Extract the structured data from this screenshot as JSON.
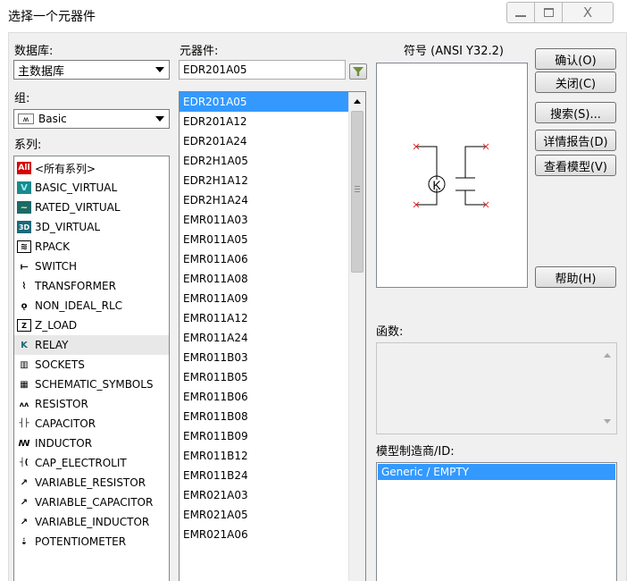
{
  "window": {
    "title": "选择一个元器件",
    "controls": {
      "minimize": "—",
      "maximize": "□",
      "close": "X"
    }
  },
  "database": {
    "label": "数据库:",
    "selected": "主数据库"
  },
  "group": {
    "label": "组:",
    "selected": "Basic"
  },
  "series": {
    "label": "系列:",
    "items": [
      {
        "label": "<所有系列>",
        "icon": "all-series-icon",
        "glyph": "All",
        "selected": false
      },
      {
        "label": "BASIC_VIRTUAL",
        "icon": "basic-virtual-icon",
        "glyph": "V",
        "selected": false
      },
      {
        "label": "RATED_VIRTUAL",
        "icon": "rated-virtual-icon",
        "glyph": "~",
        "selected": false
      },
      {
        "label": "3D_VIRTUAL",
        "icon": "3d-virtual-icon",
        "glyph": "3D",
        "selected": false
      },
      {
        "label": "RPACK",
        "icon": "rpack-icon",
        "glyph": "≋",
        "selected": false
      },
      {
        "label": "SWITCH",
        "icon": "switch-icon",
        "glyph": "⟝",
        "selected": false
      },
      {
        "label": "TRANSFORMER",
        "icon": "transformer-icon",
        "glyph": "⌇",
        "selected": false
      },
      {
        "label": "NON_IDEAL_RLC",
        "icon": "non-ideal-rlc-icon",
        "glyph": "ǫ",
        "selected": false
      },
      {
        "label": "Z_LOAD",
        "icon": "z-load-icon",
        "glyph": "Z",
        "selected": false
      },
      {
        "label": "RELAY",
        "icon": "relay-icon",
        "glyph": "K",
        "selected": true
      },
      {
        "label": "SOCKETS",
        "icon": "sockets-icon",
        "glyph": "▥",
        "selected": false
      },
      {
        "label": "SCHEMATIC_SYMBOLS",
        "icon": "schematic-symbols-icon",
        "glyph": "▦",
        "selected": false
      },
      {
        "label": "RESISTOR",
        "icon": "resistor-icon",
        "glyph": "ʌʌ",
        "selected": false
      },
      {
        "label": "CAPACITOR",
        "icon": "capacitor-icon",
        "glyph": "┤├",
        "selected": false
      },
      {
        "label": "INDUCTOR",
        "icon": "inductor-icon",
        "glyph": "ꟿ",
        "selected": false
      },
      {
        "label": "CAP_ELECTROLIT",
        "icon": "cap-electrolit-icon",
        "glyph": "┤(",
        "selected": false
      },
      {
        "label": "VARIABLE_RESISTOR",
        "icon": "variable-resistor-icon",
        "glyph": "↗",
        "selected": false
      },
      {
        "label": "VARIABLE_CAPACITOR",
        "icon": "variable-capacitor-icon",
        "glyph": "↗",
        "selected": false
      },
      {
        "label": "VARIABLE_INDUCTOR",
        "icon": "variable-inductor-icon",
        "glyph": "↗",
        "selected": false
      },
      {
        "label": "POTENTIOMETER",
        "icon": "potentiometer-icon",
        "glyph": "⇣",
        "selected": false
      }
    ]
  },
  "components": {
    "label": "元器件:",
    "search_value": "EDR201A05",
    "items": [
      {
        "label": "EDR201A05",
        "selected": true
      },
      {
        "label": "EDR201A12",
        "selected": false
      },
      {
        "label": "EDR201A24",
        "selected": false
      },
      {
        "label": "EDR2H1A05",
        "selected": false
      },
      {
        "label": "EDR2H1A12",
        "selected": false
      },
      {
        "label": "EDR2H1A24",
        "selected": false
      },
      {
        "label": "EMR011A03",
        "selected": false
      },
      {
        "label": "EMR011A05",
        "selected": false
      },
      {
        "label": "EMR011A06",
        "selected": false
      },
      {
        "label": "EMR011A08",
        "selected": false
      },
      {
        "label": "EMR011A09",
        "selected": false
      },
      {
        "label": "EMR011A12",
        "selected": false
      },
      {
        "label": "EMR011A24",
        "selected": false
      },
      {
        "label": "EMR011B03",
        "selected": false
      },
      {
        "label": "EMR011B05",
        "selected": false
      },
      {
        "label": "EMR011B06",
        "selected": false
      },
      {
        "label": "EMR011B08",
        "selected": false
      },
      {
        "label": "EMR011B09",
        "selected": false
      },
      {
        "label": "EMR011B12",
        "selected": false
      },
      {
        "label": "EMR011B24",
        "selected": false
      },
      {
        "label": "EMR021A03",
        "selected": false
      },
      {
        "label": "EMR021A05",
        "selected": false
      },
      {
        "label": "EMR021A06",
        "selected": false
      }
    ]
  },
  "symbol": {
    "label": "符号 (ANSI Y32.2)",
    "coil_letter": "K"
  },
  "buttons": {
    "ok": "确认(O)",
    "close": "关闭(C)",
    "search": "搜索(S)...",
    "detail_report": "详情报告(D)",
    "view_model": "查看模型(V)",
    "help": "帮助(H)"
  },
  "function": {
    "label": "函数:"
  },
  "manufacturer": {
    "label": "模型制造商/ID:",
    "items": [
      {
        "label": "Generic / EMPTY",
        "selected": true
      }
    ]
  },
  "colors": {
    "selection": "#3399ff",
    "client_bg": "#f0f0f0",
    "pin_marker": "#e03030"
  }
}
